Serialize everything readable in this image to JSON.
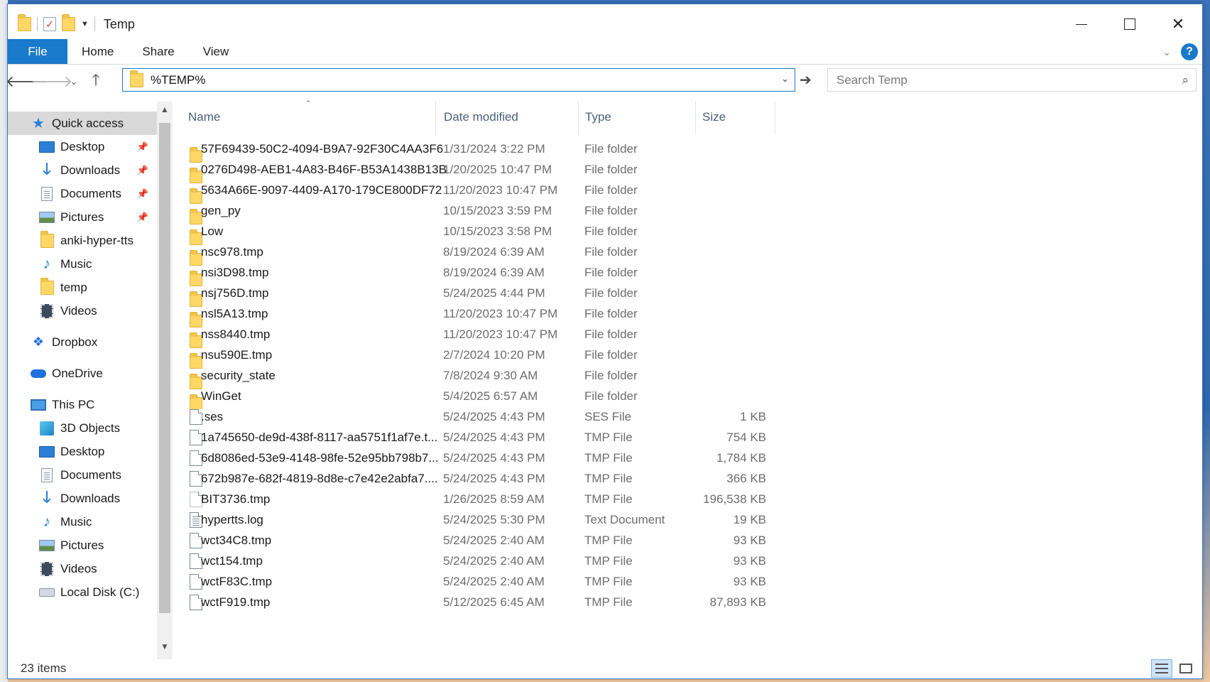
{
  "window": {
    "title": "Temp",
    "controls": {
      "minimize": "minimize",
      "maximize": "maximize",
      "close": "close"
    }
  },
  "ribbon": {
    "tabs": [
      "File",
      "Home",
      "Share",
      "View"
    ],
    "help": "?"
  },
  "address": {
    "value": "%TEMP%",
    "search_placeholder": "Search Temp"
  },
  "nav": {
    "items": [
      {
        "label": "Quick access",
        "icon": "star-icon",
        "indent": 0,
        "selected": true,
        "pinned": false
      },
      {
        "label": "Desktop",
        "icon": "desktop-icon",
        "indent": 1,
        "pinned": true
      },
      {
        "label": "Downloads",
        "icon": "downloads-icon",
        "indent": 1,
        "pinned": true
      },
      {
        "label": "Documents",
        "icon": "documents-icon",
        "indent": 1,
        "pinned": true
      },
      {
        "label": "Pictures",
        "icon": "pictures-icon",
        "indent": 1,
        "pinned": true
      },
      {
        "label": "anki-hyper-tts",
        "icon": "folder-icon",
        "indent": 1,
        "pinned": false
      },
      {
        "label": "Music",
        "icon": "music-icon",
        "indent": 1,
        "pinned": false
      },
      {
        "label": "temp",
        "icon": "folder-icon",
        "indent": 1,
        "pinned": false
      },
      {
        "label": "Videos",
        "icon": "videos-icon",
        "indent": 1,
        "pinned": false
      },
      {
        "label": "Dropbox",
        "icon": "dropbox-icon",
        "indent": 0,
        "pinned": false
      },
      {
        "label": "OneDrive",
        "icon": "onedrive-icon",
        "indent": 0,
        "pinned": false
      },
      {
        "label": "This PC",
        "icon": "this-pc-icon",
        "indent": 0,
        "pinned": false
      },
      {
        "label": "3D Objects",
        "icon": "3d-objects-icon",
        "indent": 1,
        "pinned": false
      },
      {
        "label": "Desktop",
        "icon": "desktop-icon",
        "indent": 1,
        "pinned": false
      },
      {
        "label": "Documents",
        "icon": "documents-icon",
        "indent": 1,
        "pinned": false
      },
      {
        "label": "Downloads",
        "icon": "downloads-icon",
        "indent": 1,
        "pinned": false
      },
      {
        "label": "Music",
        "icon": "music-icon",
        "indent": 1,
        "pinned": false
      },
      {
        "label": "Pictures",
        "icon": "pictures-icon",
        "indent": 1,
        "pinned": false
      },
      {
        "label": "Videos",
        "icon": "videos-icon",
        "indent": 1,
        "pinned": false
      },
      {
        "label": "Local Disk (C:)",
        "icon": "local-disk-icon",
        "indent": 1,
        "pinned": false
      }
    ]
  },
  "columns": {
    "name": "Name",
    "date": "Date modified",
    "type": "Type",
    "size": "Size"
  },
  "files": [
    {
      "name": "57F69439-50C2-4094-B9A7-92F30C4AA3F6",
      "date": "1/31/2024 3:22 PM",
      "type": "File folder",
      "size": "",
      "kind": "folder"
    },
    {
      "name": "0276D498-AEB1-4A83-B46F-B53A1438B13B",
      "date": "1/20/2025 10:47 PM",
      "type": "File folder",
      "size": "",
      "kind": "folder"
    },
    {
      "name": "5634A66E-9097-4409-A170-179CE800DF72",
      "date": "11/20/2023 10:47 PM",
      "type": "File folder",
      "size": "",
      "kind": "folder"
    },
    {
      "name": "gen_py",
      "date": "10/15/2023 3:59 PM",
      "type": "File folder",
      "size": "",
      "kind": "folder"
    },
    {
      "name": "Low",
      "date": "10/15/2023 3:58 PM",
      "type": "File folder",
      "size": "",
      "kind": "folder"
    },
    {
      "name": "nsc978.tmp",
      "date": "8/19/2024 6:39 AM",
      "type": "File folder",
      "size": "",
      "kind": "folder"
    },
    {
      "name": "nsi3D98.tmp",
      "date": "8/19/2024 6:39 AM",
      "type": "File folder",
      "size": "",
      "kind": "folder"
    },
    {
      "name": "nsj756D.tmp",
      "date": "5/24/2025 4:44 PM",
      "type": "File folder",
      "size": "",
      "kind": "folder"
    },
    {
      "name": "nsl5A13.tmp",
      "date": "11/20/2023 10:47 PM",
      "type": "File folder",
      "size": "",
      "kind": "folder"
    },
    {
      "name": "nss8440.tmp",
      "date": "11/20/2023 10:47 PM",
      "type": "File folder",
      "size": "",
      "kind": "folder"
    },
    {
      "name": "nsu590E.tmp",
      "date": "2/7/2024 10:20 PM",
      "type": "File folder",
      "size": "",
      "kind": "folder"
    },
    {
      "name": "security_state",
      "date": "7/8/2024 9:30 AM",
      "type": "File folder",
      "size": "",
      "kind": "folder"
    },
    {
      "name": "WinGet",
      "date": "5/4/2025 6:57 AM",
      "type": "File folder",
      "size": "",
      "kind": "folder"
    },
    {
      "name": ".ses",
      "date": "5/24/2025 4:43 PM",
      "type": "SES File",
      "size": "1 KB",
      "kind": "file"
    },
    {
      "name": "1a745650-de9d-438f-8117-aa5751f1af7e.t...",
      "date": "5/24/2025 4:43 PM",
      "type": "TMP File",
      "size": "754 KB",
      "kind": "file"
    },
    {
      "name": "6d8086ed-53e9-4148-98fe-52e95bb798b7...",
      "date": "5/24/2025 4:43 PM",
      "type": "TMP File",
      "size": "1,784 KB",
      "kind": "file"
    },
    {
      "name": "672b987e-682f-4819-8d8e-c7e42e2abfa7....",
      "date": "5/24/2025 4:43 PM",
      "type": "TMP File",
      "size": "366 KB",
      "kind": "file"
    },
    {
      "name": "BIT3736.tmp",
      "date": "1/26/2025 8:59 AM",
      "type": "TMP File",
      "size": "196,538 KB",
      "kind": "file-dim"
    },
    {
      "name": "hypertts.log",
      "date": "5/24/2025 5:30 PM",
      "type": "Text Document",
      "size": "19 KB",
      "kind": "text"
    },
    {
      "name": "wct34C8.tmp",
      "date": "5/24/2025 2:40 AM",
      "type": "TMP File",
      "size": "93 KB",
      "kind": "file"
    },
    {
      "name": "wct154.tmp",
      "date": "5/24/2025 2:40 AM",
      "type": "TMP File",
      "size": "93 KB",
      "kind": "file"
    },
    {
      "name": "wctF83C.tmp",
      "date": "5/24/2025 2:40 AM",
      "type": "TMP File",
      "size": "93 KB",
      "kind": "file"
    },
    {
      "name": "wctF919.tmp",
      "date": "5/12/2025 6:45 AM",
      "type": "TMP File",
      "size": "87,893 KB",
      "kind": "file"
    }
  ],
  "status": {
    "items": "23 items"
  },
  "colors": {
    "accent": "#1979ca",
    "selection": "#d9d9d9",
    "header_text": "#4c607a"
  }
}
